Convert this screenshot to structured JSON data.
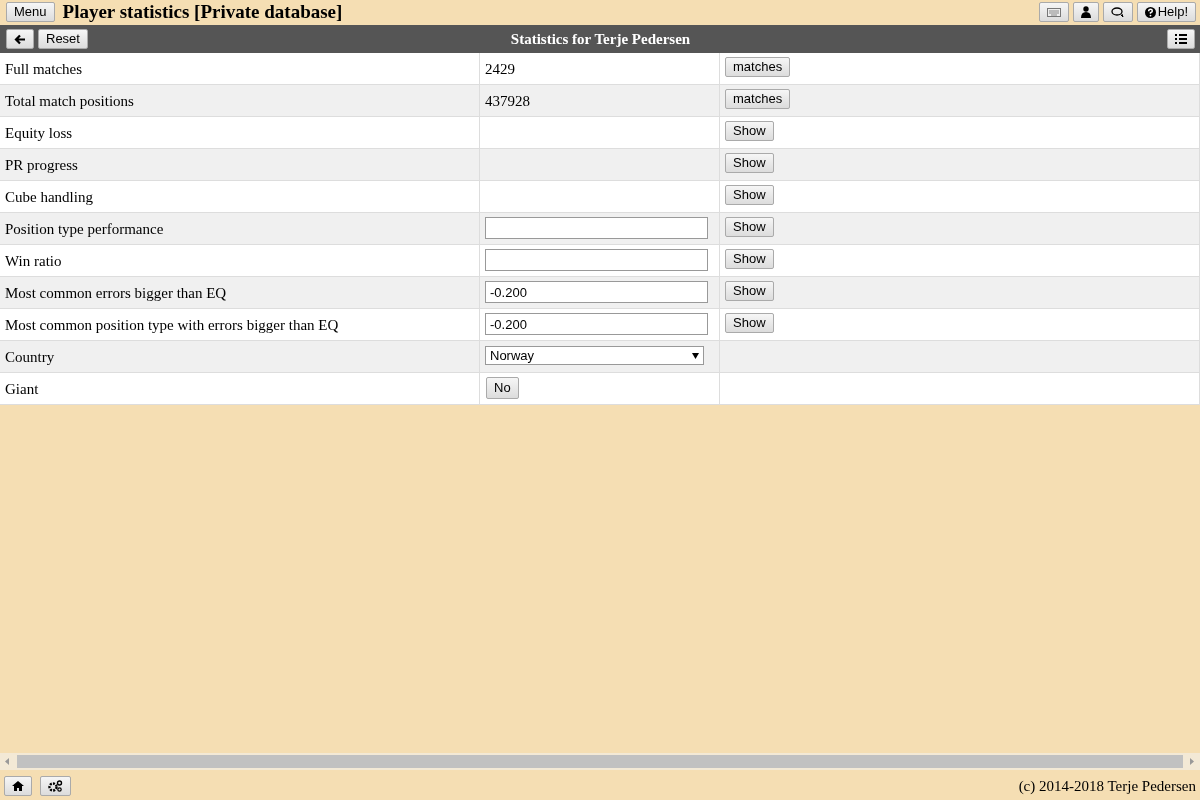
{
  "header": {
    "menu_button": "Menu",
    "title": "Player statistics [Private database]",
    "help_button": "Help!"
  },
  "toolbar": {
    "reset_button": "Reset",
    "title": "Statistics for Terje Pedersen"
  },
  "rows": [
    {
      "label": "Full matches",
      "kind": "text",
      "value": "2429",
      "button": "matches"
    },
    {
      "label": "Total match positions",
      "kind": "text",
      "value": "437928",
      "button": "matches"
    },
    {
      "label": "Equity loss",
      "kind": "empty",
      "button": "Show"
    },
    {
      "label": "PR progress",
      "kind": "empty",
      "button": "Show"
    },
    {
      "label": "Cube handling",
      "kind": "empty",
      "button": "Show"
    },
    {
      "label": "Position type performance",
      "kind": "input",
      "button": "Show"
    },
    {
      "label": "Win ratio",
      "kind": "input",
      "button": "Show"
    },
    {
      "label": "Most common errors bigger than EQ",
      "kind": "input",
      "value": "-0.200",
      "button": "Show"
    },
    {
      "label": "Most common position type with errors bigger than EQ",
      "kind": "input",
      "value": "-0.200",
      "button": "Show"
    },
    {
      "label": "Country",
      "kind": "select",
      "value": "Norway"
    },
    {
      "label": "Giant",
      "kind": "toggle",
      "value": "No"
    }
  ],
  "footer": {
    "copyright": "(c) 2014-2018 Terje Pedersen"
  }
}
